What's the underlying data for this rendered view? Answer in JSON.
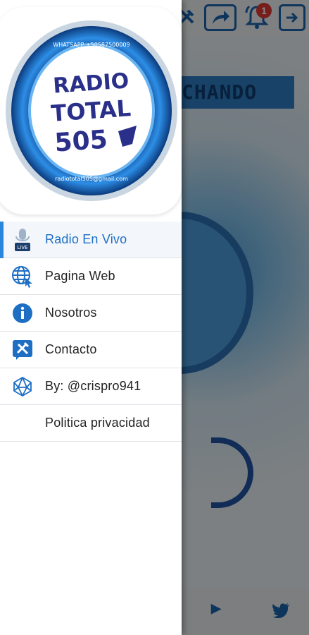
{
  "background": {
    "notification_count": "1",
    "banner_text": "CHANDO"
  },
  "drawer": {
    "logo": {
      "line1": "RADIO",
      "line2": "TOTAL",
      "line3": "505",
      "ring_text_top": "WHATSAPP +50587500009",
      "ring_text_bottom": "radiototal505@gmail.com"
    },
    "menu": [
      {
        "label": "Radio En Vivo",
        "icon": "radio-mic-icon",
        "active": true
      },
      {
        "label": "Pagina Web",
        "icon": "globe-cursor-icon",
        "active": false
      },
      {
        "label": "Nosotros",
        "icon": "info-icon",
        "active": false
      },
      {
        "label": "Contacto",
        "icon": "tools-icon",
        "active": false
      },
      {
        "label": "By: @crispro941",
        "icon": "polyhedron-icon",
        "active": false
      },
      {
        "label": "Politica privacidad",
        "icon": "",
        "active": false
      }
    ]
  },
  "colors": {
    "accent": "#1e6fc4",
    "brand_blue": "#1b67b0",
    "badge": "#e53935"
  }
}
